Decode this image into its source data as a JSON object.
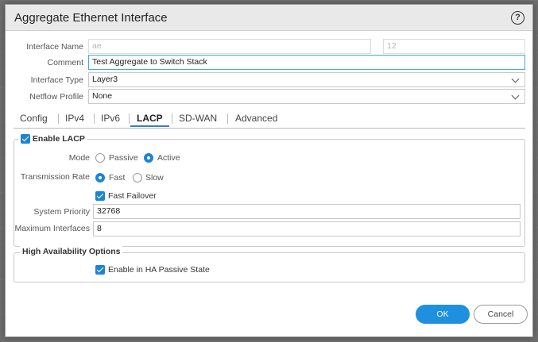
{
  "dialog": {
    "title": "Aggregate Ethernet Interface",
    "help_icon": "question-circle-icon",
    "help_label": "?"
  },
  "form": {
    "interface_name_label": "Interface Name",
    "interface_name_prefix": "ae",
    "interface_name_number": "12",
    "comment_label": "Comment",
    "comment_value": "Test Aggregate to Switch Stack",
    "interface_type_label": "Interface Type",
    "interface_type_value": "Layer3",
    "netflow_profile_label": "Netflow Profile",
    "netflow_profile_value": "None"
  },
  "tabs": [
    {
      "label": "Config"
    },
    {
      "label": "IPv4"
    },
    {
      "label": "IPv6"
    },
    {
      "label": "LACP"
    },
    {
      "label": "SD-WAN"
    },
    {
      "label": "Advanced"
    }
  ],
  "active_tab": "LACP",
  "lacp": {
    "enable_label": "Enable LACP",
    "enabled": true,
    "mode_label": "Mode",
    "mode_options": [
      "Passive",
      "Active"
    ],
    "mode_selected": "Active",
    "rate_label": "Transmission Rate",
    "rate_options": [
      "Fast",
      "Slow"
    ],
    "rate_selected": "Fast",
    "fast_failover_label": "Fast Failover",
    "fast_failover_checked": true,
    "system_priority_label": "System Priority",
    "system_priority_value": "32768",
    "max_interfaces_label": "Maximum Interfaces",
    "max_interfaces_value": "8"
  },
  "ha": {
    "title": "High Availability Options",
    "enable_passive_label": "Enable in HA Passive State",
    "enable_passive_checked": true
  },
  "buttons": {
    "ok_label": "OK",
    "cancel_label": "Cancel"
  },
  "colors": {
    "accent": "#1e90e0",
    "focus_border": "#3fa8e6"
  }
}
